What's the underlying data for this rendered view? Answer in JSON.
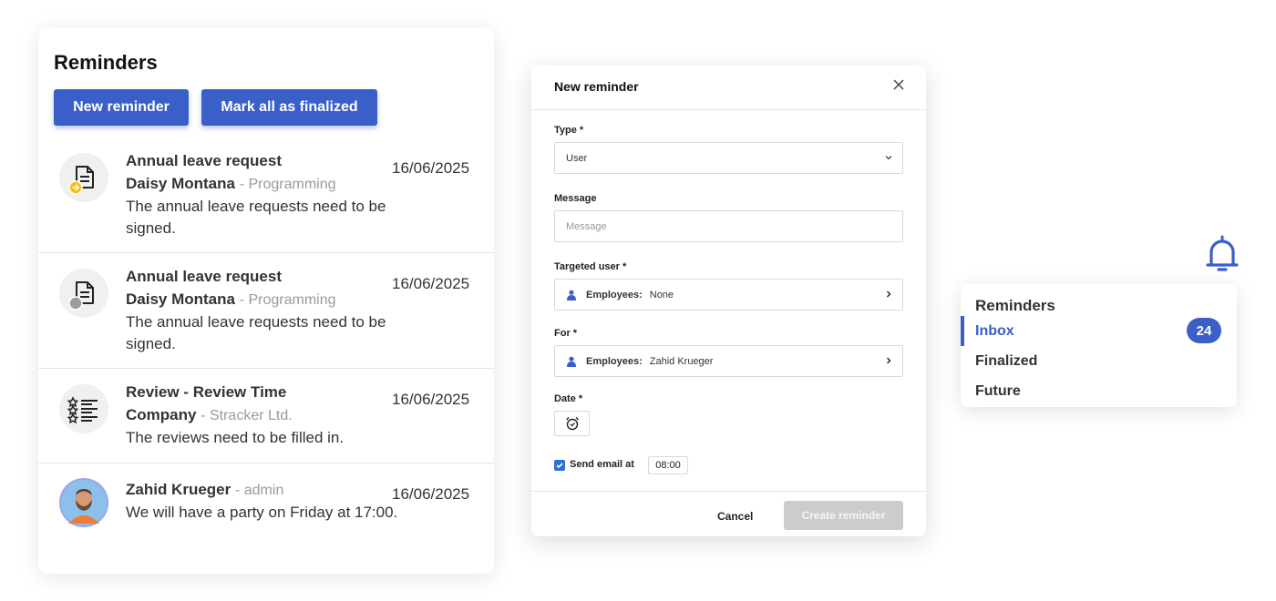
{
  "reminders_panel": {
    "title": "Reminders",
    "new_reminder_label": "New reminder",
    "mark_all_label": "Mark all as finalized",
    "items": [
      {
        "icon": "document-arrow-icon",
        "heading": "Annual leave request",
        "name": "Daisy Montana",
        "sub": "- Programming",
        "message": "The annual leave requests need to be signed.",
        "date": "16/06/2025"
      },
      {
        "icon": "document-grey-icon",
        "heading": "Annual leave request",
        "name": "Daisy Montana",
        "sub": "- Programming",
        "message": "The annual leave requests need to be signed.",
        "date": "16/06/2025"
      },
      {
        "icon": "star-checklist-icon",
        "heading": "Review - Review Time",
        "name": "Company",
        "sub": "- Stracker Ltd.",
        "message": "The reviews need to be filled in.",
        "date": "16/06/2025"
      },
      {
        "icon": "user-avatar",
        "heading": "",
        "name": "Zahid Krueger",
        "sub": "- admin",
        "message": "We will have a party on Friday at 17:00.",
        "date": "16/06/2025"
      }
    ]
  },
  "modal": {
    "title": "New reminder",
    "type_label": "Type *",
    "type_value": "User",
    "message_label": "Message",
    "message_placeholder": "Message",
    "targeted_label": "Targeted user *",
    "targeted_key": "Employees:",
    "targeted_value": "None",
    "for_label": "For *",
    "for_key": "Employees:",
    "for_value": "Zahid Krueger",
    "date_label": "Date *",
    "send_email_label": "Send email at",
    "send_email_checked": true,
    "send_time": "08:00",
    "cancel_label": "Cancel",
    "create_label": "Create reminder"
  },
  "side_menu": {
    "title": "Reminders",
    "items": [
      {
        "label": "Inbox",
        "active": true,
        "badge": "24"
      },
      {
        "label": "Finalized",
        "active": false
      },
      {
        "label": "Future",
        "active": false
      }
    ]
  },
  "colors": {
    "accent": "#3b5fc9",
    "disabled": "#cccccc",
    "badge_yellow": "#f2c21b"
  }
}
